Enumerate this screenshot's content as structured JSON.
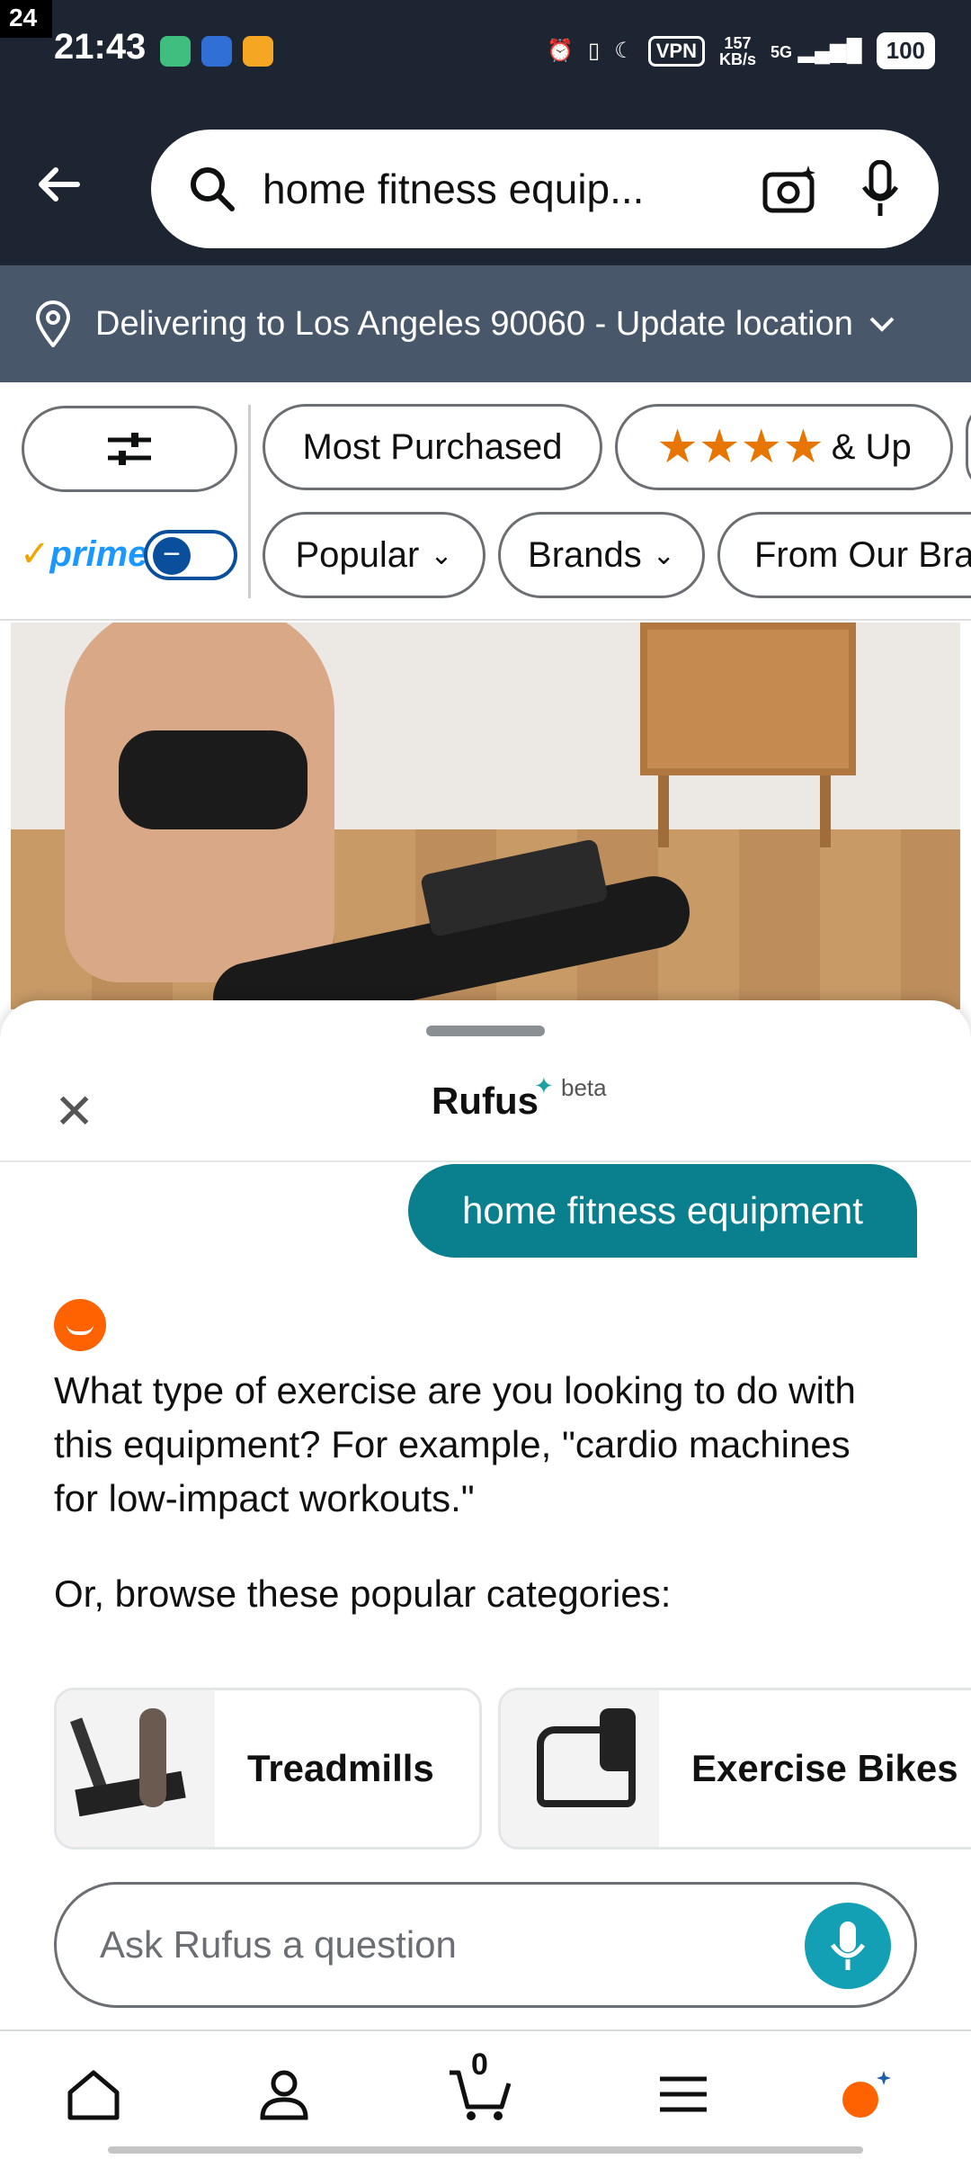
{
  "status_bar": {
    "corner_badge": "24",
    "time": "21:43",
    "vpn": "VPN",
    "speed_value": "157",
    "speed_unit": "KB/s",
    "network": "5G",
    "battery": "100"
  },
  "search": {
    "query": "home fitness equip..."
  },
  "location": {
    "text": "Delivering to Los Angeles 90060 - Update location"
  },
  "filters": {
    "most_purchased": "Most Purchased",
    "rating_suffix": "& Up",
    "prime_label": "prime",
    "popular": "Popular",
    "brands": "Brands",
    "from_our_brands": "From Our Brands"
  },
  "rufus": {
    "title": "Rufus",
    "beta": "beta",
    "user_message": "home fitness equipment",
    "assistant_message": "What type of exercise are you looking to do with this equipment? For example, \"cardio machines for low-impact workouts.\"",
    "browse_prompt": "Or, browse these popular categories:",
    "categories": [
      {
        "label": "Treadmills"
      },
      {
        "label": "Exercise Bikes"
      }
    ],
    "ask_placeholder": "Ask Rufus a question"
  },
  "bottom_nav": {
    "cart_count": "0"
  },
  "colors": {
    "header_bg": "#1c2531",
    "location_bg": "#485769",
    "user_bubble": "#0a7f8e",
    "rufus_orange": "#ff6200",
    "mic_teal": "#14a0b4",
    "star": "#e77600"
  }
}
